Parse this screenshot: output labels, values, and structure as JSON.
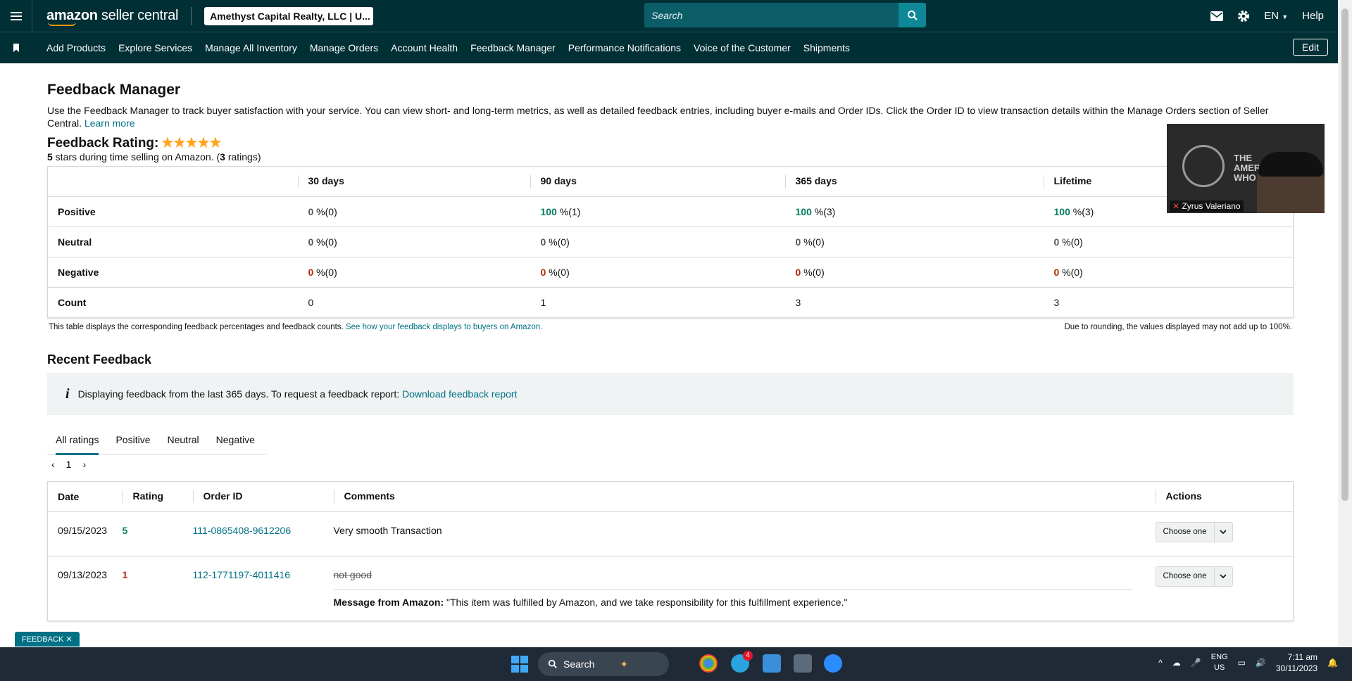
{
  "header": {
    "logo_amazon": "amazon",
    "logo_sc": " seller central",
    "account": "Amethyst Capital Realty, LLC | U...",
    "search_placeholder": "Search",
    "lang": "EN",
    "help": "Help"
  },
  "nav": {
    "items": [
      "Add Products",
      "Explore Services",
      "Manage All Inventory",
      "Manage Orders",
      "Account Health",
      "Feedback Manager",
      "Performance Notifications",
      "Voice of the Customer",
      "Shipments"
    ],
    "edit": "Edit"
  },
  "page": {
    "title": "Feedback Manager",
    "description": "Use the Feedback Manager to track buyer satisfaction with your service. You can view short- and long-term metrics, as well as detailed feedback entries, including buyer e-mails and Order IDs. Click the Order ID to view transaction details within the Manage Orders section of Seller Central.",
    "learn_more": "Learn more",
    "rating_title": "Feedback Rating:",
    "stars": "★★★★★",
    "rating_stars": "5",
    "rating_sub_mid": " stars during time selling on Amazon. (",
    "rating_count": "3",
    "rating_sub_end": " ratings)"
  },
  "feedback_table": {
    "columns": [
      "30 days",
      "90 days",
      "365 days",
      "Lifetime"
    ],
    "rows": [
      {
        "label": "Positive",
        "cells": [
          {
            "v": "0",
            "u": " %(0)"
          },
          {
            "v": "100",
            "u": " %(1)"
          },
          {
            "v": "100",
            "u": " %(3)"
          },
          {
            "v": "100",
            "u": " %(3)"
          }
        ]
      },
      {
        "label": "Neutral",
        "cells": [
          {
            "v": "0",
            "u": " %(0)"
          },
          {
            "v": "0",
            "u": " %(0)"
          },
          {
            "v": "0",
            "u": " %(0)"
          },
          {
            "v": "0",
            "u": " %(0)"
          }
        ]
      },
      {
        "label": "Negative",
        "cells": [
          {
            "v": "0",
            "u": " %(0)"
          },
          {
            "v": "0",
            "u": " %(0)"
          },
          {
            "v": "0",
            "u": " %(0)"
          },
          {
            "v": "0",
            "u": " %(0)"
          }
        ]
      },
      {
        "label": "Count",
        "cells": [
          {
            "v": "0",
            "u": ""
          },
          {
            "v": "1",
            "u": ""
          },
          {
            "v": "3",
            "u": ""
          },
          {
            "v": "3",
            "u": ""
          }
        ]
      }
    ],
    "note_left": "This table displays the corresponding feedback percentages and feedback counts.",
    "note_link": "See how your feedback displays to buyers on Amazon.",
    "note_right": "Due to rounding, the values displayed may not add up to 100%."
  },
  "recent": {
    "title": "Recent Feedback",
    "info_text": "Displaying feedback from the last 365 days. To request a feedback report:",
    "info_link": "Download feedback report",
    "tabs": [
      "All ratings",
      "Positive",
      "Neutral",
      "Negative"
    ],
    "page": "1",
    "columns": {
      "date": "Date",
      "rating": "Rating",
      "order": "Order ID",
      "comments": "Comments",
      "actions": "Actions"
    },
    "rows": [
      {
        "date": "09/15/2023",
        "rating": "5",
        "order": "111-0865408-9612206",
        "comment": "Very smooth Transaction",
        "action": "Choose one"
      },
      {
        "date": "09/13/2023",
        "rating": "1",
        "order": "112-1771197-4011416",
        "comment": "not good",
        "message_label": "Message from Amazon:",
        "message": " \"This item was fulfilled by Amazon, and we take responsibility for this fulfillment experience.\"",
        "action": "Choose one"
      }
    ]
  },
  "video": {
    "name": "Zyrus Valeriano",
    "brand_text": "THE\nAMERI\nWHO"
  },
  "feedback_tab": "FEEDBACK",
  "taskbar": {
    "search": "Search",
    "lang1": "ENG",
    "lang2": "US",
    "time": "7:11 am",
    "date": "30/11/2023",
    "badge": "4"
  },
  "colors": {
    "header": "#002f36",
    "link": "#007185",
    "positive": "#067d62",
    "negative": "#b12704"
  }
}
